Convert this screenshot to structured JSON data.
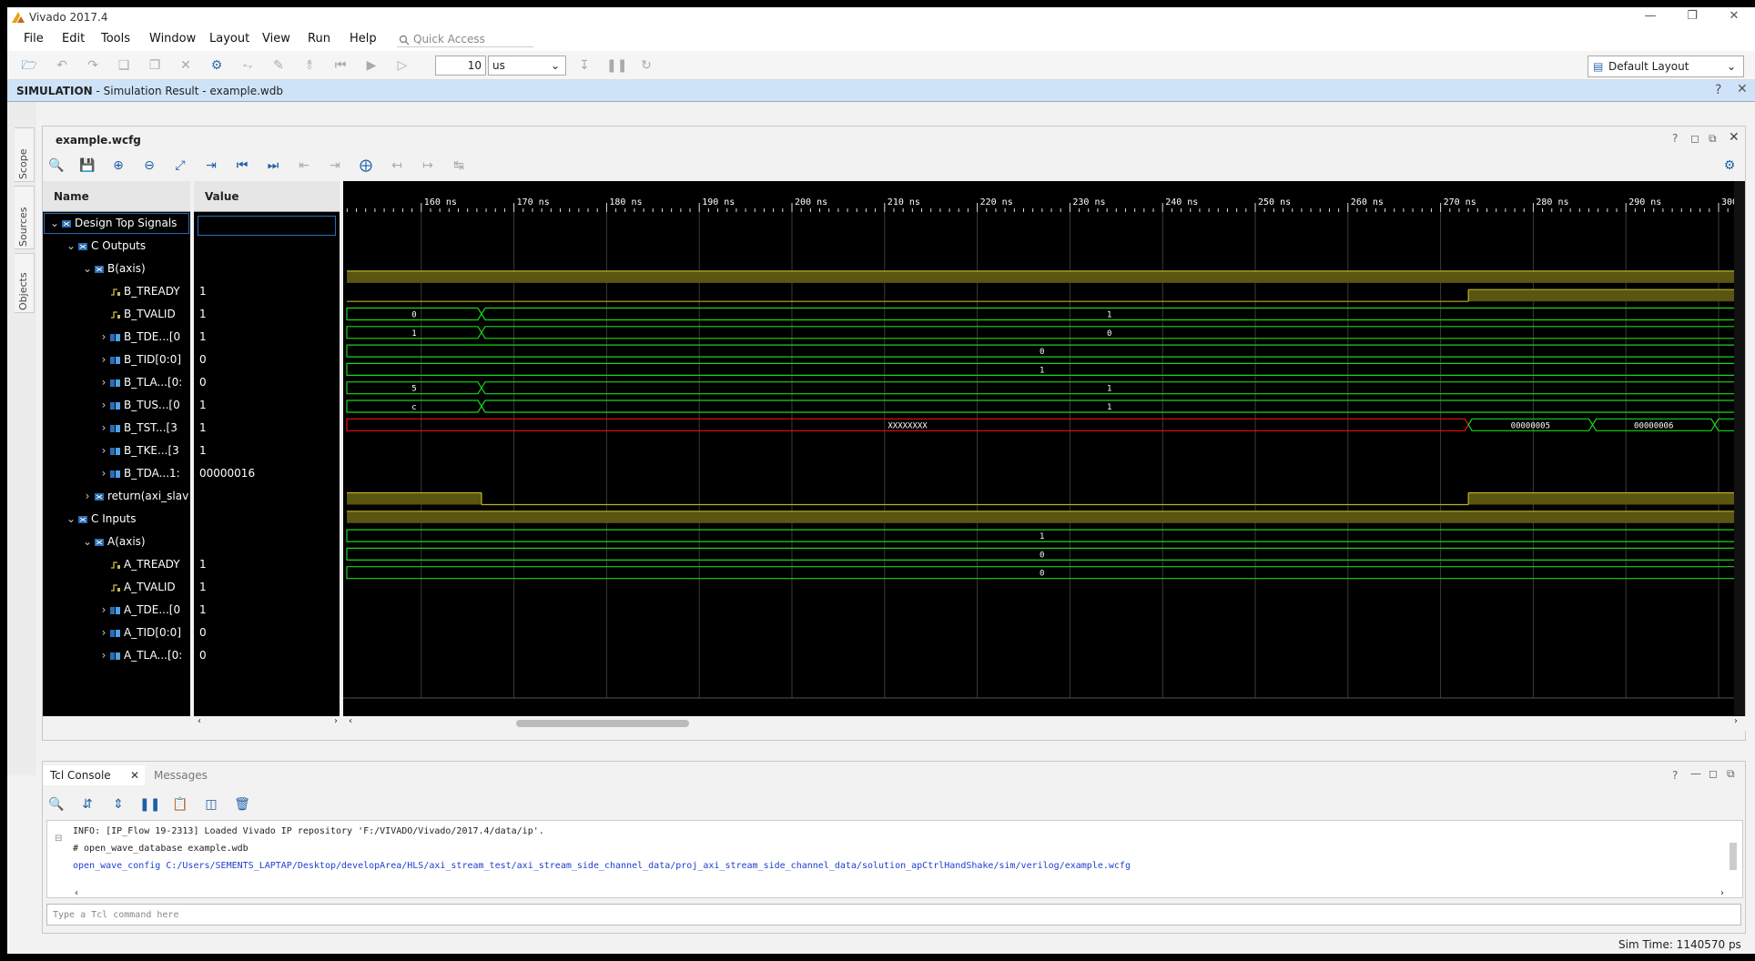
{
  "window": {
    "title": "Vivado 2017.4"
  },
  "menu": [
    "File",
    "Edit",
    "Tools",
    "Window",
    "Layout",
    "View",
    "Run",
    "Help"
  ],
  "quick_access": "Quick Access",
  "toolbar": {
    "time_value": "10",
    "time_unit": "us",
    "layout": "Default Layout"
  },
  "sim_banner": {
    "label": "SIMULATION",
    "text": " - Simulation Result - example.wdb"
  },
  "side_tabs": [
    "Scope",
    "Sources",
    "Objects"
  ],
  "wave": {
    "tab_title": "example.wcfg",
    "name_header": "Name",
    "value_header": "Value",
    "time_labels": [
      "160 ns",
      "170 ns",
      "180 ns",
      "190 ns",
      "200 ns",
      "210 ns",
      "220 ns",
      "230 ns",
      "240 ns",
      "250 ns",
      "260 ns",
      "270 ns",
      "280 ns",
      "290 ns",
      "300"
    ],
    "rows": [
      {
        "name": "Design Top Signals",
        "value": "",
        "level": 0,
        "kind": "group",
        "exp": "v"
      },
      {
        "name": "C Outputs",
        "value": "",
        "level": 1,
        "kind": "group",
        "exp": "v"
      },
      {
        "name": "B(axis)",
        "value": "",
        "level": 2,
        "kind": "group",
        "exp": "v"
      },
      {
        "name": "B_TREADY",
        "value": "1",
        "level": 3,
        "kind": "bit",
        "exp": ""
      },
      {
        "name": "B_TVALID",
        "value": "1",
        "level": 3,
        "kind": "bit",
        "exp": ""
      },
      {
        "name": "B_TDE...[0",
        "value": "1",
        "level": 3,
        "kind": "bus",
        "exp": ">"
      },
      {
        "name": "B_TID[0:0]",
        "value": "0",
        "level": 3,
        "kind": "bus",
        "exp": ">"
      },
      {
        "name": "B_TLA...[0:",
        "value": "0",
        "level": 3,
        "kind": "bus",
        "exp": ">"
      },
      {
        "name": "B_TUS...[0",
        "value": "1",
        "level": 3,
        "kind": "bus",
        "exp": ">"
      },
      {
        "name": "B_TST...[3",
        "value": "1",
        "level": 3,
        "kind": "bus",
        "exp": ">"
      },
      {
        "name": "B_TKE...[3",
        "value": "1",
        "level": 3,
        "kind": "bus",
        "exp": ">"
      },
      {
        "name": "B_TDA...1:",
        "value": "00000016",
        "level": 3,
        "kind": "bus",
        "exp": ">"
      },
      {
        "name": "return(axi_slav",
        "value": "",
        "level": 2,
        "kind": "group",
        "exp": ">"
      },
      {
        "name": "C Inputs",
        "value": "",
        "level": 1,
        "kind": "group",
        "exp": "v"
      },
      {
        "name": "A(axis)",
        "value": "",
        "level": 2,
        "kind": "group",
        "exp": "v"
      },
      {
        "name": "A_TREADY",
        "value": "1",
        "level": 3,
        "kind": "bit",
        "exp": ""
      },
      {
        "name": "A_TVALID",
        "value": "1",
        "level": 3,
        "kind": "bit",
        "exp": ""
      },
      {
        "name": "A_TDE...[0",
        "value": "1",
        "level": 3,
        "kind": "bus",
        "exp": ">"
      },
      {
        "name": "A_TID[0:0]",
        "value": "0",
        "level": 3,
        "kind": "bus",
        "exp": ">"
      },
      {
        "name": "A_TLA...[0:",
        "value": "0",
        "level": 3,
        "kind": "bus",
        "exp": ">"
      }
    ],
    "bus_labels": {
      "b_tde": [
        "0",
        "1"
      ],
      "b_tid": [
        "1",
        "0"
      ],
      "b_tla": "0",
      "b_tus": "1",
      "b_tst": [
        "5",
        "1"
      ],
      "b_tke": [
        "c",
        "1"
      ],
      "b_tda": [
        "XXXXXXXX",
        "00000005",
        "00000006"
      ],
      "a_tde": "1",
      "a_tid": "0",
      "a_tla": "0"
    }
  },
  "console": {
    "tabs": [
      "Tcl Console",
      "Messages"
    ],
    "lines": [
      "INFO: [IP_Flow 19-2313] Loaded Vivado IP repository 'F:/VIVADO/Vivado/2017.4/data/ip'.",
      "# open_wave_database example.wdb",
      "open_wave_config C:/Users/SEMENTS_LAPTAP/Desktop/developArea/HLS/axi_stream_test/axi_stream_side_channel_data/proj_axi_stream_side_channel_data/solution_apCtrlHandShake/sim/verilog/example.wcfg"
    ],
    "placeholder": "Type a Tcl command here"
  },
  "status": {
    "sim_time": "Sim Time: 1140570 ps"
  },
  "colors": {
    "wave_bit": "#b9b12a",
    "wave_bus": "#19d619",
    "wave_x": "#e11",
    "cursor_bg": "#000"
  }
}
